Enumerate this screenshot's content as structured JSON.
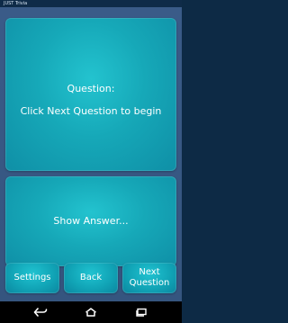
{
  "status_bar": {
    "title": "JUST Trivia"
  },
  "question_panel": {
    "title": "Question:",
    "text": "Click Next Question to begin"
  },
  "answer_panel": {
    "text": "Show Answer..."
  },
  "buttons": {
    "settings": "Settings",
    "back": "Back",
    "next": "Next\nQuestion"
  },
  "nav": {
    "back_icon": "back-arrow-icon",
    "home_icon": "home-icon",
    "recent_icon": "recent-apps-icon"
  },
  "colors": {
    "background": "#2f4f7a",
    "panel": "#16a8b8",
    "text": "#ffffff",
    "nav_bar": "#000000"
  }
}
